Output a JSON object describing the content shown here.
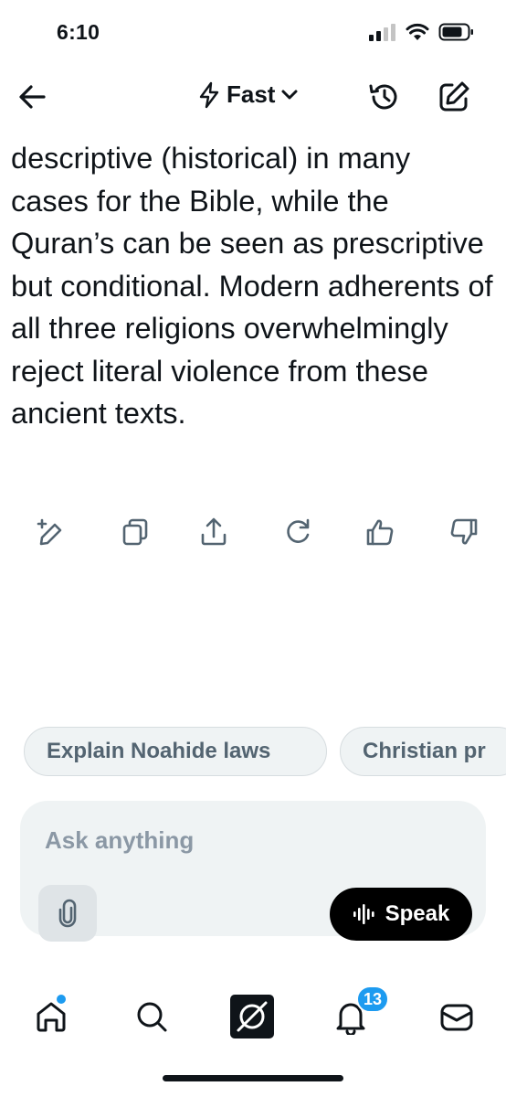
{
  "status_bar": {
    "time": "6:10"
  },
  "header": {
    "mode_label": "Fast"
  },
  "response": {
    "text": "descriptive (historical) in many cases for the Bible, while the Quran’s can be seen as prescriptive but conditional. Modern adherents of all three religions overwhelmingly reject literal violence from these ancient texts."
  },
  "actions": [
    {
      "icon": "edit-sparkle-icon"
    },
    {
      "icon": "copy-icon"
    },
    {
      "icon": "share-icon"
    },
    {
      "icon": "regenerate-icon"
    },
    {
      "icon": "thumbs-up-icon"
    },
    {
      "icon": "thumbs-down-icon"
    }
  ],
  "suggestions": [
    {
      "label": "Explain Noahide laws"
    },
    {
      "label": "Christian pr"
    }
  ],
  "composer": {
    "placeholder": "Ask anything",
    "speak_label": "Speak"
  },
  "nav": {
    "notifications_badge": "13",
    "accent": "#1d9bf0"
  }
}
